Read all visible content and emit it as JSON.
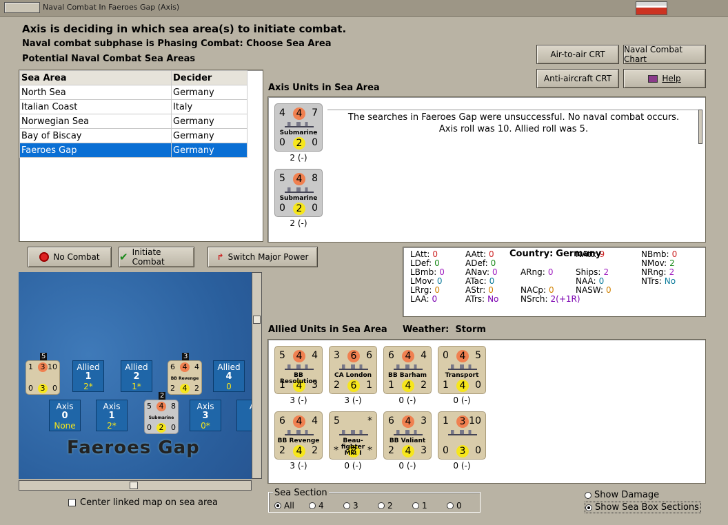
{
  "window": {
    "title": "Naval Combat In Faeroes Gap (Axis)"
  },
  "header": {
    "line1": "Axis is deciding in which sea area(s) to initiate combat.",
    "line2": "Naval combat subphase is Phasing Combat: Choose Sea Area",
    "line3": "Potential Naval Combat Sea Areas"
  },
  "buttons": {
    "air_to_air": "Air-to-air CRT",
    "naval_chart": "Naval Combat Chart",
    "anti_aircraft": "Anti-aircraft CRT",
    "help": "Help",
    "no_combat": "No Combat",
    "initiate": "Initiate Combat",
    "switch": "Switch Major Power"
  },
  "sea_table": {
    "headers": [
      "Sea Area",
      "Decider"
    ],
    "rows": [
      [
        "North Sea",
        "Germany"
      ],
      [
        "Italian Coast",
        "Italy"
      ],
      [
        "Norwegian Sea",
        "Germany"
      ],
      [
        "Bay of Biscay",
        "Germany"
      ],
      [
        "Faeroes Gap",
        "Germany"
      ]
    ],
    "selected": 4
  },
  "axis": {
    "title": "Axis Units in Sea Area",
    "message1": "The searches in Faeroes Gap were unsuccessful.  No naval combat occurs.",
    "message2": "Axis roll was 10.  Allied roll was 5.",
    "units": [
      {
        "tl": "4",
        "tc": "4",
        "tr": "7",
        "name": "Submarine",
        "bl": "0",
        "bc": "2",
        "br": "0",
        "sub": "2 (-)"
      },
      {
        "tl": "5",
        "tc": "4",
        "tr": "8",
        "name": "Submarine",
        "bl": "0",
        "bc": "2",
        "br": "0",
        "sub": "2 (-)"
      }
    ]
  },
  "stats": {
    "country_label": "Country:",
    "country": "Germany",
    "c1": [
      [
        "LAtt:",
        "0"
      ],
      [
        "LDef:",
        "0"
      ],
      [
        "LBmb:",
        "0"
      ],
      [
        "LMov:",
        "0"
      ],
      [
        "LRrg:",
        "0"
      ],
      [
        "LAA:",
        "0"
      ]
    ],
    "c2": [
      [
        "AAtt:",
        "0"
      ],
      [
        "ADef:",
        "0"
      ],
      [
        "ANav:",
        "0"
      ],
      [
        "ATac:",
        "0"
      ],
      [
        "AStr:",
        "0"
      ],
      [
        "ATrs:",
        "No"
      ]
    ],
    "c3": [
      [
        "",
        ""
      ],
      [
        "",
        ""
      ],
      [
        "ARng:",
        "0"
      ],
      [
        "",
        ""
      ],
      [
        "NACp:",
        "0"
      ],
      [
        "NSrch:",
        "2(+1R)"
      ]
    ],
    "c4": [
      [
        "NAtt:",
        "9"
      ],
      [
        "",
        ""
      ],
      [
        "Ships:",
        "2"
      ],
      [
        "NAA:",
        "0"
      ],
      [
        "NASW:",
        "0"
      ],
      [
        "",
        ""
      ]
    ],
    "c5": [
      [
        "NBmb:",
        "0"
      ],
      [
        "NMov:",
        "2"
      ],
      [
        "NRng:",
        "2"
      ],
      [
        "NTrs:",
        "No"
      ]
    ]
  },
  "allied": {
    "title": "Allied Units in Sea Area",
    "weather_label": "Weather:",
    "weather": "Storm",
    "units": [
      {
        "tl": "5",
        "tc": "4",
        "tr": "4",
        "name": "BB Resolution",
        "bl": "1",
        "bc": "4",
        "br": "3",
        "sub": "3 (-)"
      },
      {
        "tl": "3",
        "tc": "6",
        "tr": "6",
        "name": "CA London",
        "bl": "2",
        "bc": "6",
        "br": "1",
        "sub": "3 (-)"
      },
      {
        "tl": "6",
        "tc": "4",
        "tr": "4",
        "name": "BB Barham",
        "bl": "1",
        "bc": "4",
        "br": "2",
        "sub": "0 (-)"
      },
      {
        "tl": "0",
        "tc": "4",
        "tr": "5",
        "name": "Transport",
        "bl": "1",
        "bc": "4",
        "br": "0",
        "sub": "0 (-)"
      },
      {
        "tl": "6",
        "tc": "4",
        "tr": "4",
        "name": "BB Revenge",
        "bl": "2",
        "bc": "4",
        "br": "2",
        "sub": "3 (-)"
      },
      {
        "tl": "5",
        "tc": "",
        "tr": "*",
        "name": "Beau-\nfighter\nMk. I",
        "bl": "*",
        "bc": "8",
        "br": "*",
        "sub": "0 (-)"
      },
      {
        "tl": "6",
        "tc": "4",
        "tr": "3",
        "name": "BB Valiant",
        "bl": "2",
        "bc": "4",
        "br": "3",
        "sub": "0 (-)"
      },
      {
        "tl": "1",
        "tc": "3",
        "tr": "10",
        "name": "",
        "bl": "0",
        "bc": "3",
        "br": "0",
        "sub": "0 (-)"
      }
    ]
  },
  "map": {
    "title": "Faeroes Gap",
    "allied_boxes": [
      [
        "Allied",
        "1",
        "2*"
      ],
      [
        "Allied",
        "2",
        "1*"
      ],
      [
        "Allied",
        "4",
        "0"
      ]
    ],
    "axis_boxes": [
      [
        "Axis",
        "0",
        "None"
      ],
      [
        "Axis",
        "1",
        "2*"
      ],
      [
        "Axis",
        "3",
        "0*"
      ],
      [
        "A",
        "",
        " "
      ]
    ],
    "stack1": {
      "badge": "5",
      "tl": "1",
      "tc": "3",
      "tr": "10",
      "bl": "0",
      "bc": "3",
      "br": "0"
    },
    "stack2": {
      "badge": "3",
      "tl": "6",
      "tc": "4",
      "tr": "4",
      "name": "BB Revenge",
      "bl": "2",
      "bc": "4",
      "br": "2"
    },
    "stack3": {
      "badge": "2",
      "tl": "5",
      "tc": "4",
      "tr": "8",
      "name": "Submarine",
      "bl": "0",
      "bc": "2",
      "br": "0"
    }
  },
  "center_link": "Center linked map on sea area",
  "sea_section": {
    "label": "Sea Section",
    "options": [
      "All",
      "4",
      "3",
      "2",
      "1",
      "0"
    ],
    "selected": "All"
  },
  "options": {
    "show_damage": "Show Damage",
    "show_sections": "Show Sea Box Sections"
  }
}
